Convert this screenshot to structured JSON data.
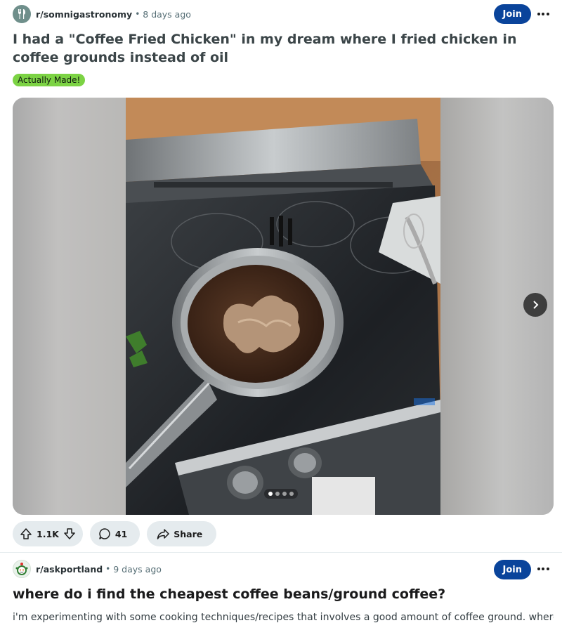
{
  "post1": {
    "subreddit": "r/somnigastronomy",
    "time_ago": "8 days ago",
    "join_label": "Join",
    "title": "I had a \"Coffee Fried Chicken\" in my dream where I fried chicken in coffee grounds instead of oil",
    "flair": "Actually Made!",
    "carousel": {
      "total": 4,
      "active": 1
    },
    "votes": "1.1K",
    "comments": "41",
    "share_label": "Share",
    "icons": [
      "fork-knife-icon",
      "upvote-icon",
      "downvote-icon",
      "comment-icon",
      "share-icon",
      "more-icon",
      "chevron-right-icon"
    ]
  },
  "post2": {
    "subreddit": "r/askportland",
    "time_ago": "9 days ago",
    "join_label": "Join",
    "title": "where do i find the cheapest coffee beans/ground coffee?",
    "excerpt": "i'm experimenting with some cooking techniques/recipes that involves a good amount of coffee ground. where"
  },
  "colors": {
    "join_button": "#0a449b",
    "flair_bg": "#7cd344",
    "action_pill_bg": "#e5ebee",
    "meta_text": "#576f76"
  }
}
